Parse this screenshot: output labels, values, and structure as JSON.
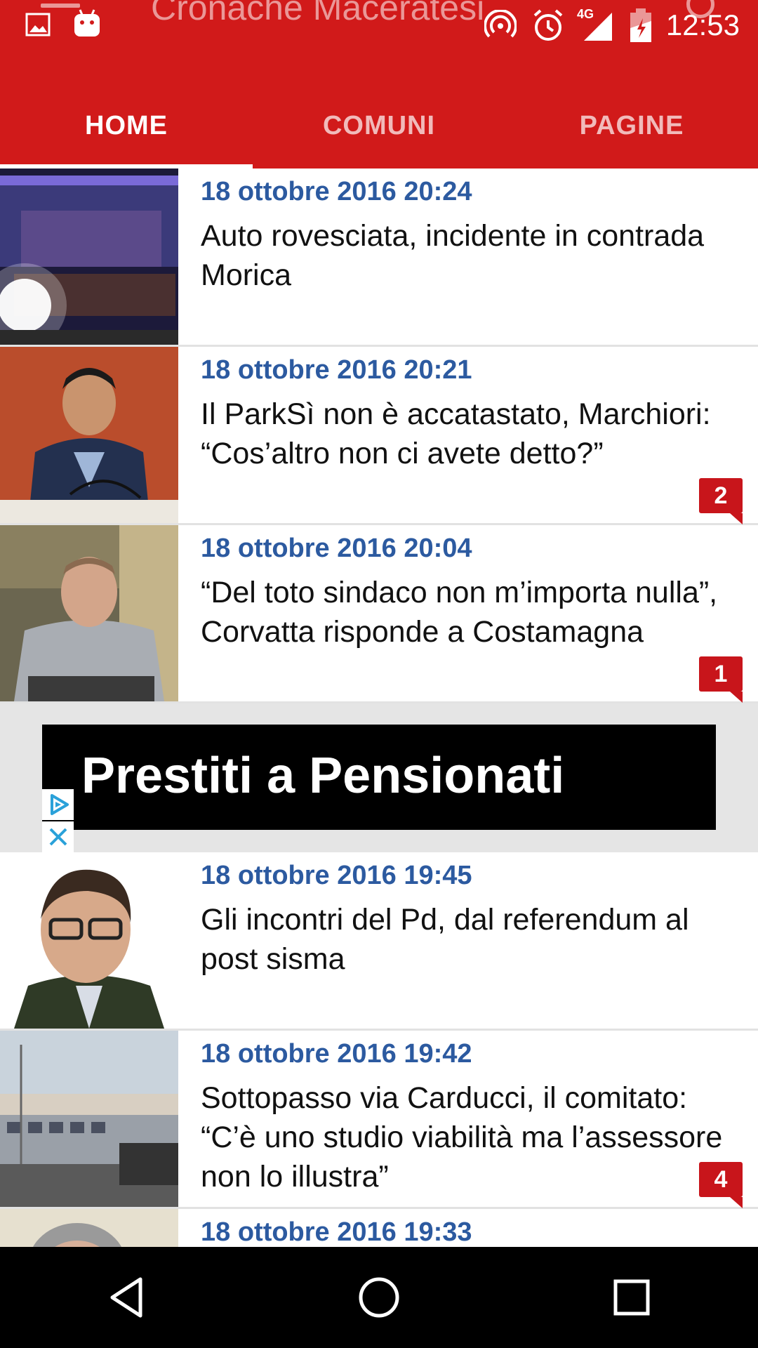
{
  "status_bar": {
    "time": "12:53",
    "network": "4G",
    "icons": [
      "gallery-icon",
      "android-icon",
      "hotspot-icon",
      "alarm-icon",
      "signal-icon",
      "battery-icon"
    ]
  },
  "app_bar": {
    "title": "Cronache Maceratesi",
    "accent_color": "#d11a1a"
  },
  "tabs": [
    {
      "label": "HOME",
      "active": true
    },
    {
      "label": "COMUNI",
      "active": false
    },
    {
      "label": "PAGINE",
      "active": false
    }
  ],
  "articles": [
    {
      "date": "18 ottobre 2016 20:24",
      "title": "Auto rovesciata, incidente in contrada Morica",
      "comments": ""
    },
    {
      "date": "18 ottobre 2016 20:21",
      "title": "Il ParkSì non è accatastato, Marchiori: “Cos’altro non ci avete detto?”",
      "comments": "2"
    },
    {
      "date": "18 ottobre 2016 20:04",
      "title": "“Del toto sindaco non m’importa nulla”, Corvatta risponde a Costamagna",
      "comments": "1"
    },
    {
      "date": "18 ottobre 2016 19:45",
      "title": "Gli incontri del Pd, dal referendum al post sisma",
      "comments": ""
    },
    {
      "date": "18 ottobre 2016 19:42",
      "title": "Sottopasso via Carducci, il comitato: “C’è uno studio viabilità ma l’assessore non lo illustra”",
      "comments": "4"
    },
    {
      "date": "18 ottobre 2016 19:33",
      "title": "",
      "comments": ""
    }
  ],
  "ad": {
    "text": "Prestiti a Pensionati"
  },
  "nav": [
    "back-icon",
    "home-icon",
    "recents-icon"
  ]
}
